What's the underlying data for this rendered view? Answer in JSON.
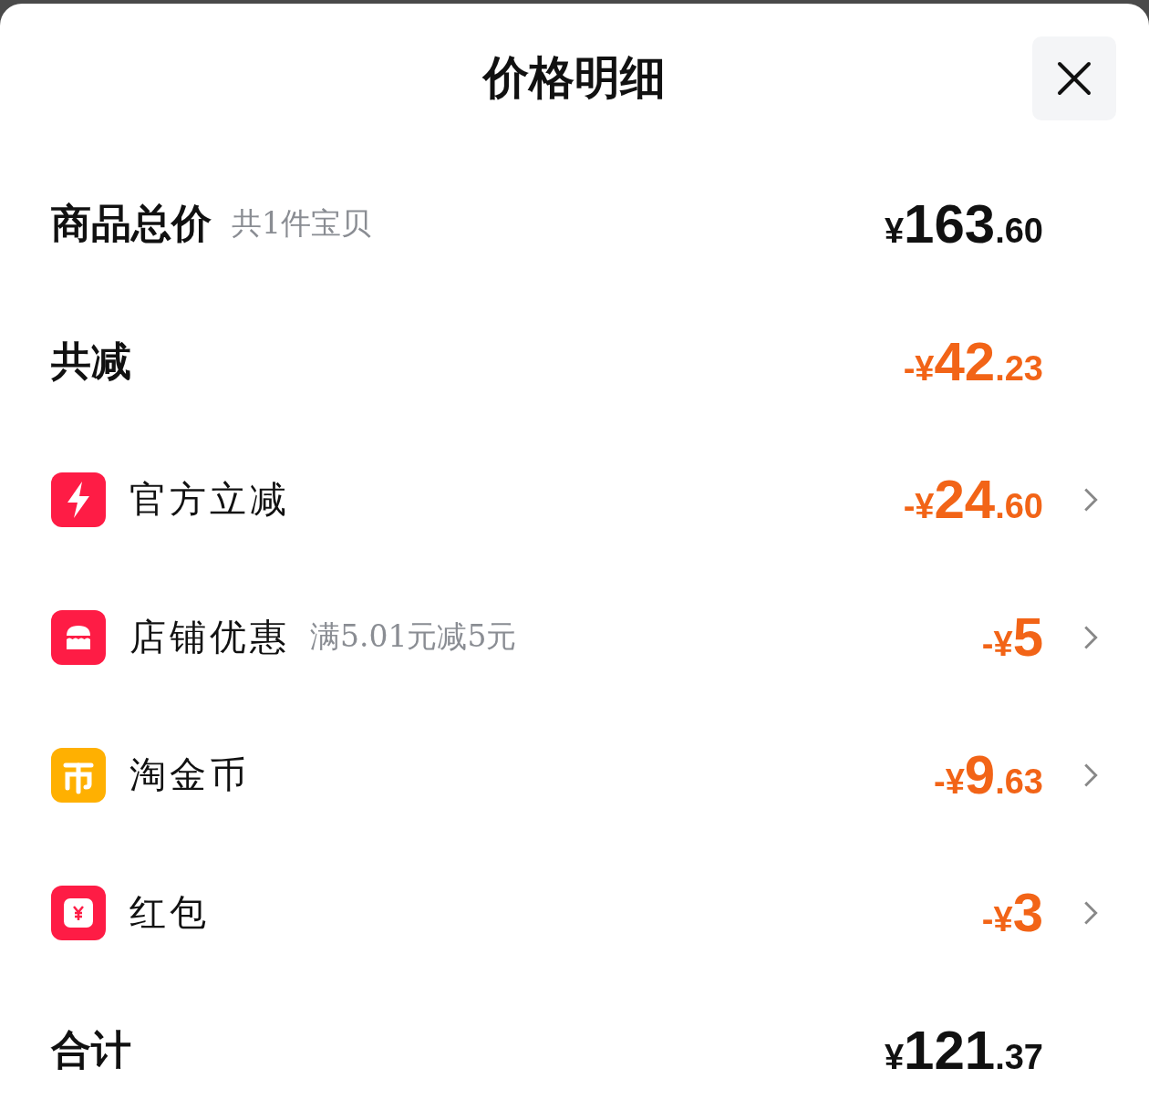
{
  "title": "价格明细",
  "rows": [
    {
      "kind": "summary",
      "label": "商品总价",
      "note": "共1件宝贝",
      "amount": {
        "sign": "¥",
        "integer": "163",
        "decimal": ".60"
      },
      "discount": false
    },
    {
      "kind": "summary",
      "label": "共减",
      "amount": {
        "sign": "-¥",
        "integer": "42",
        "decimal": ".23"
      },
      "discount": true
    },
    {
      "kind": "bolt",
      "color": "#fe1c45",
      "label": "官方立减",
      "amount": {
        "sign": "-¥",
        "integer": "24",
        "decimal": ".60"
      },
      "discount": true
    },
    {
      "kind": "shop",
      "color": "#fe1c45",
      "label": "店铺优惠",
      "note": "满5.01元减5元",
      "amount": {
        "sign": "-¥",
        "integer": "5"
      },
      "discount": true
    },
    {
      "kind": "coin",
      "color": "#ffb001",
      "label": "淘金币",
      "amount": {
        "sign": "-¥",
        "integer": "9",
        "decimal": ".63"
      },
      "discount": true
    },
    {
      "kind": "packet",
      "color": "#fe1c45",
      "label": "红包",
      "amount": {
        "sign": "-¥",
        "integer": "3"
      },
      "discount": true
    },
    {
      "kind": "summary",
      "label": "合计",
      "amount": {
        "sign": "¥",
        "integer": "121",
        "decimal": ".37"
      },
      "discount": false
    }
  ]
}
